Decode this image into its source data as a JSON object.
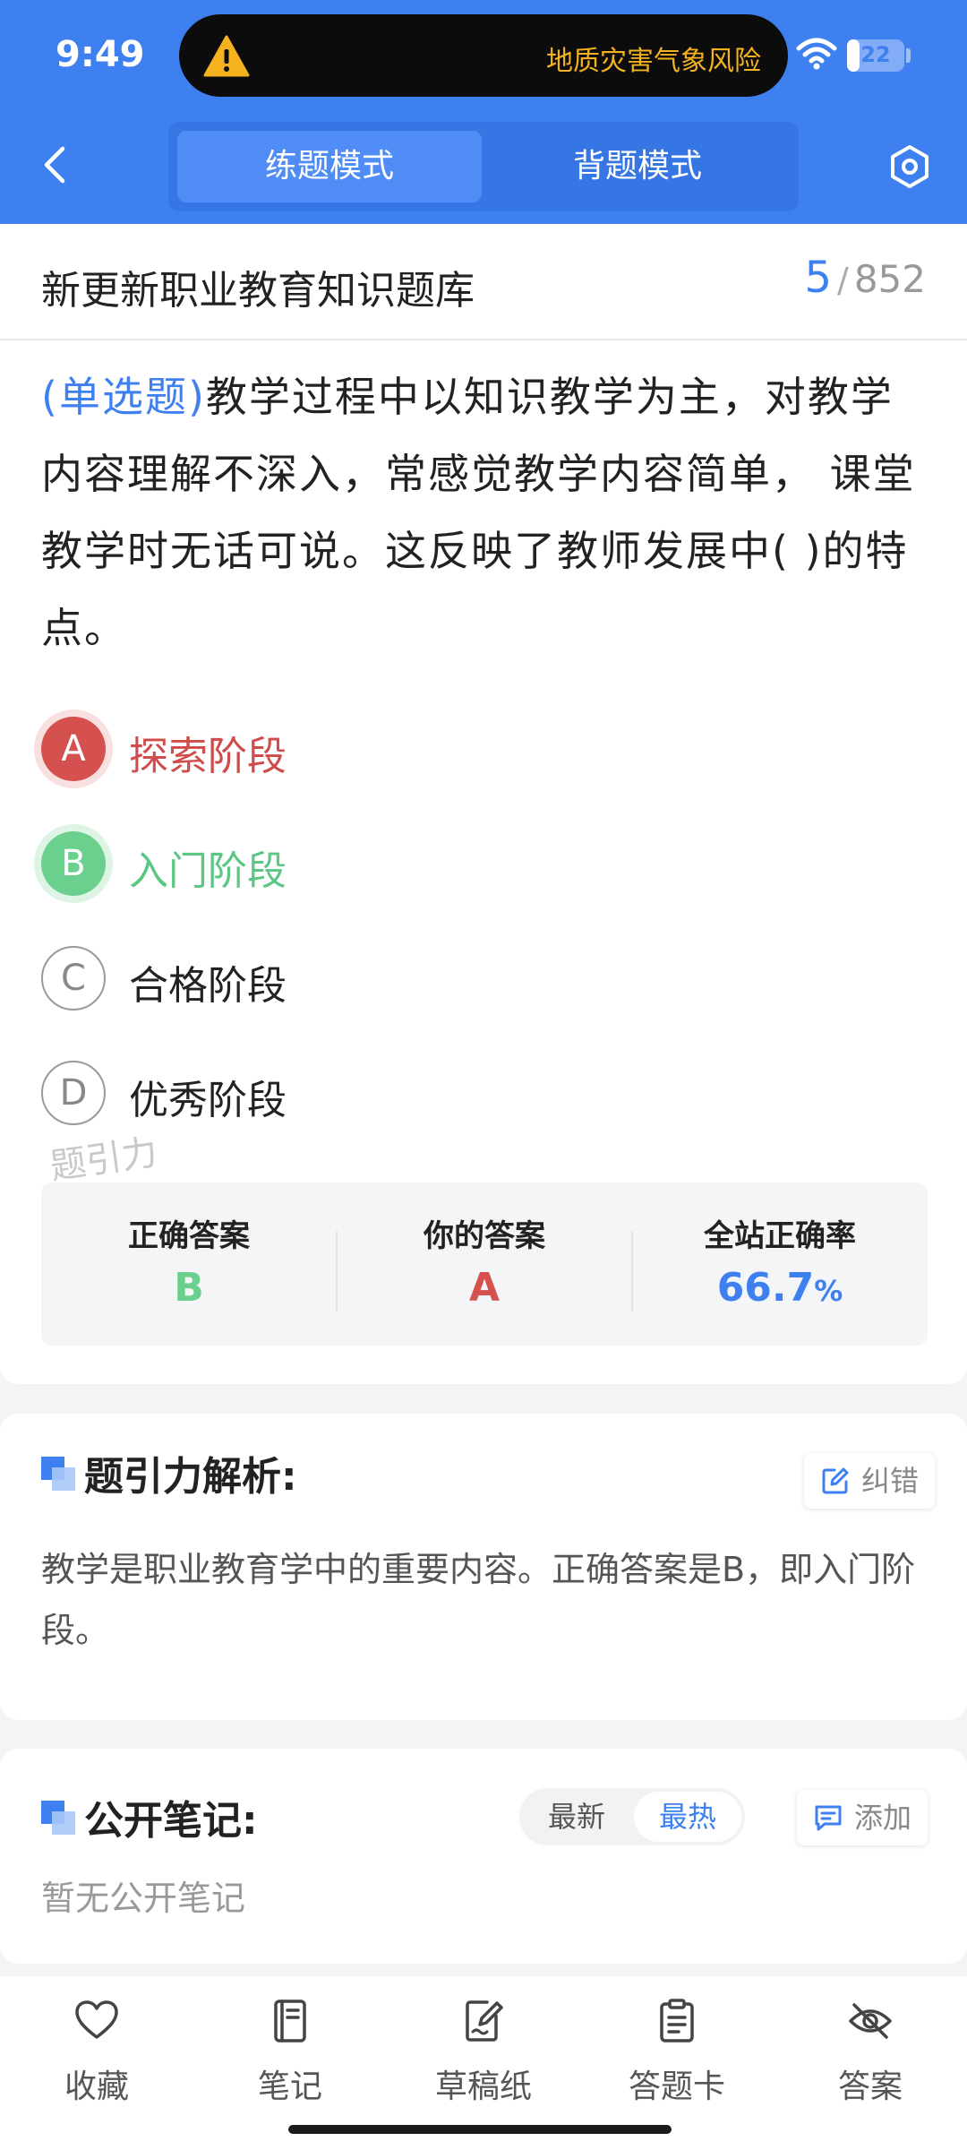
{
  "status_bar": {
    "time": "9:49",
    "alert_text": "地质灾害气象风险",
    "battery": "22",
    "battery_level_percent": 22
  },
  "header": {
    "tabs": [
      {
        "label": "练题模式",
        "active": true
      },
      {
        "label": "背题模式",
        "active": false
      }
    ]
  },
  "question_card": {
    "bank_title": "新更新职业教育知识题库",
    "current": "5",
    "separator": "/",
    "total": "852",
    "question_type": "(单选题)",
    "question_text": "教学过程中以知识教学为主，对教学内容理解不深入，常感觉教学内容简单， 课堂教学时无话可说。这反映了教师发展中(        )的特点。",
    "options": [
      {
        "letter": "A",
        "text": "探索阶段",
        "state": "wrong"
      },
      {
        "letter": "B",
        "text": "入门阶段",
        "state": "correct"
      },
      {
        "letter": "C",
        "text": "合格阶段",
        "state": "normal"
      },
      {
        "letter": "D",
        "text": "优秀阶段",
        "state": "normal"
      }
    ],
    "watermark": "题引力",
    "answer_summary": {
      "correct_label": "正确答案",
      "correct_value": "B",
      "yours_label": "你的答案",
      "yours_value": "A",
      "rate_label": "全站正确率",
      "rate_value": "66.7",
      "rate_unit": "%"
    }
  },
  "explanation": {
    "title": "题引力解析:",
    "report_button": "纠错",
    "text": "教学是职业教育学中的重要内容。正确答案是B，即入门阶段。"
  },
  "notes": {
    "title": "公开笔记:",
    "sort_options": [
      "最新",
      "最热"
    ],
    "sort_selected": "最热",
    "add_button": "添加",
    "empty_text": "暂无公开笔记"
  },
  "bottom_nav": [
    {
      "label": "收藏",
      "icon": "heart-icon"
    },
    {
      "label": "笔记",
      "icon": "notebook-icon"
    },
    {
      "label": "草稿纸",
      "icon": "draft-paper-icon"
    },
    {
      "label": "答题卡",
      "icon": "answer-card-icon"
    },
    {
      "label": "答案",
      "icon": "eye-off-icon"
    }
  ],
  "colors": {
    "primary": "#3f80f0",
    "wrong": "#d5514f",
    "correct": "#6bd08e",
    "alert": "#f4b21f"
  }
}
